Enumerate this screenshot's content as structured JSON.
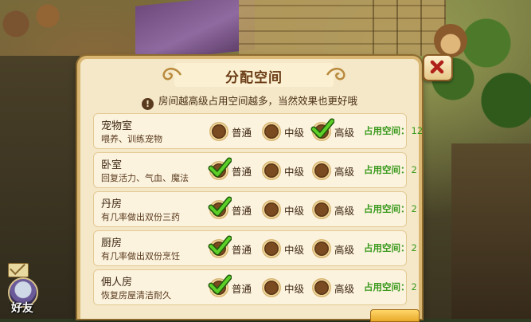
{
  "dialog": {
    "title": "分配空间",
    "hint": "房间越高级占用空间越多，当然效果也更好哦",
    "close_icon": "close-x-icon"
  },
  "space_label": "占用空间：",
  "levels": [
    "普通",
    "中级",
    "高级"
  ],
  "rooms": [
    {
      "name": "宠物室",
      "desc": "喂养、训练宠物",
      "selected": 2,
      "space": "12"
    },
    {
      "name": "卧室",
      "desc": "回复活力、气血、魔法",
      "selected": 0,
      "space": "2"
    },
    {
      "name": "丹房",
      "desc": "有几率做出双份三药",
      "selected": 0,
      "space": "2"
    },
    {
      "name": "厨房",
      "desc": "有几率做出双份烹饪",
      "selected": 0,
      "space": "2"
    },
    {
      "name": "佣人房",
      "desc": "恢复房屋清洁耐久",
      "selected": 0,
      "space": "2"
    }
  ],
  "friend": {
    "label": "好友",
    "icon": "mail-icon"
  },
  "colors": {
    "space_text": "#3a9a1e",
    "check": "#3fa21c",
    "title": "#6b3d16"
  }
}
